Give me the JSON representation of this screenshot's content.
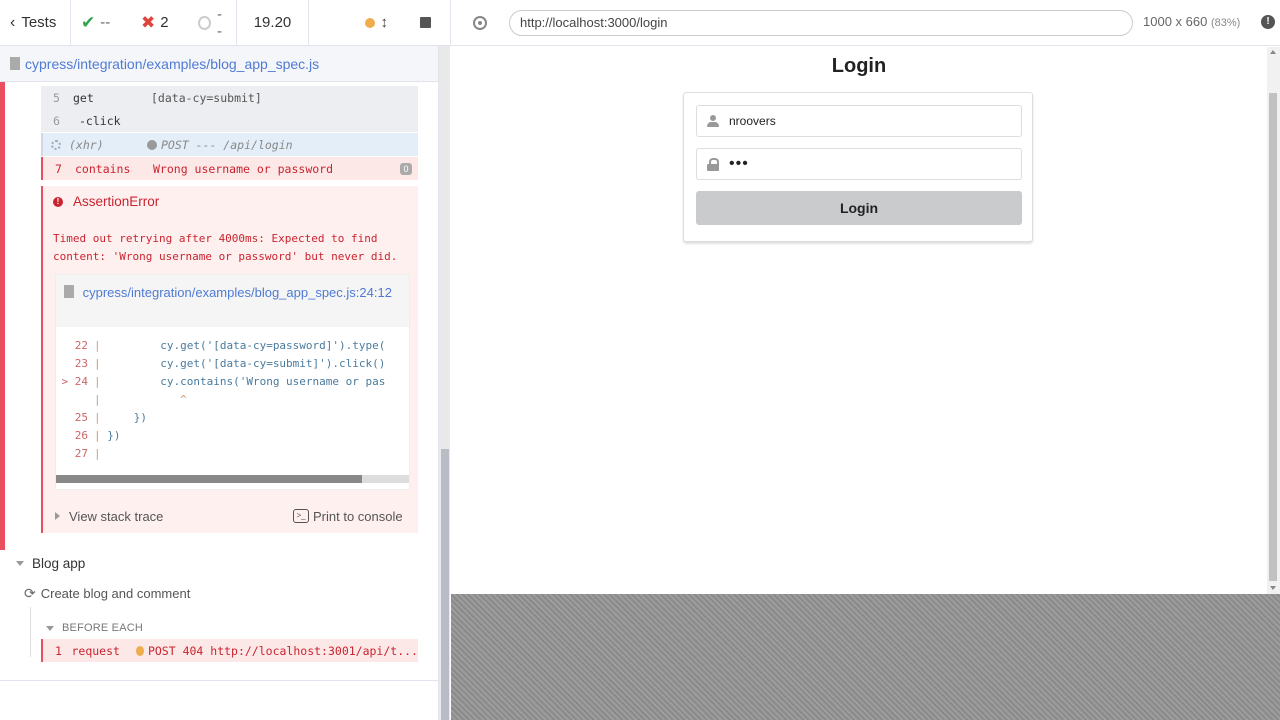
{
  "reporter": {
    "stats": {
      "tests_label": "Tests",
      "passed": "--",
      "failed": "2",
      "pending": "--",
      "duration": "19.20"
    },
    "spec_path": "cypress/integration/examples/blog_app_spec.js",
    "commands": [
      {
        "num": "5",
        "name": "get",
        "message": "[data-cy=submit]"
      },
      {
        "num": "6",
        "name": "-click",
        "message": ""
      },
      {
        "num": "",
        "name": "(xhr)",
        "message": "POST --- /api/login"
      },
      {
        "num": "7",
        "name": "contains",
        "message": "Wrong username or password",
        "badge": "0"
      }
    ],
    "error": {
      "title": "AssertionError",
      "message": "Timed out retrying after 4000ms: Expected to find content: 'Wrong username or password' but never did.",
      "file_link": "cypress/integration/examples/blog_app_spec.js:24:12",
      "code_lines": [
        {
          "ln": "22",
          "text": "        cy.get('[data-cy=password]').type("
        },
        {
          "ln": "23",
          "text": "        cy.get('[data-cy=submit]').click()"
        },
        {
          "ln": "> 24",
          "text": "        cy.contains('Wrong username or pas"
        },
        {
          "ln": "",
          "text": "           ^"
        },
        {
          "ln": "25",
          "text": "    })"
        },
        {
          "ln": "26",
          "text": "})"
        },
        {
          "ln": "27",
          "text": ""
        }
      ],
      "view_stack_trace": "View stack trace",
      "print_to_console": "Print to console"
    },
    "suite": {
      "title": "Blog app",
      "test_title": "Create blog and comment",
      "hook_title": "BEFORE EACH",
      "hook_command": {
        "num": "1",
        "name": "request",
        "message": "POST 404 http://localhost:3001/api/t..."
      }
    }
  },
  "aut": {
    "url": "http://localhost:3000/login",
    "viewport": "1000 x 660",
    "scale": "(83%)",
    "page": {
      "title": "Login",
      "username_value": "nroovers",
      "password_mask": "•••",
      "button_label": "Login"
    }
  },
  "colors": {
    "fail_red": "#e94f5f",
    "pass_green": "#2ea44f",
    "link_blue": "#4f7ad5"
  }
}
